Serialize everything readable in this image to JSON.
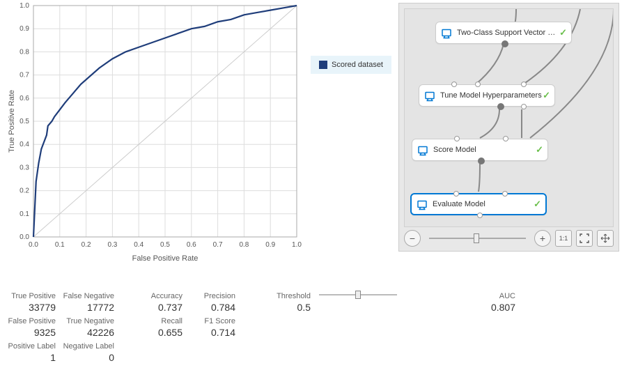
{
  "chart": {
    "xlabel": "False Positive Rate",
    "ylabel": "True Positive Rate",
    "legend": "Scored dataset"
  },
  "chart_data": {
    "type": "line",
    "title": "",
    "xlabel": "False Positive Rate",
    "ylabel": "True Positive Rate",
    "xlim": [
      0.0,
      1.0
    ],
    "ylim": [
      0.0,
      1.0
    ],
    "x_ticks": [
      0.0,
      0.1,
      0.2,
      0.3,
      0.4,
      0.5,
      0.6,
      0.7,
      0.8,
      0.9,
      1.0
    ],
    "y_ticks": [
      0.0,
      0.1,
      0.2,
      0.3,
      0.4,
      0.5,
      0.6,
      0.7,
      0.8,
      0.9,
      1.0
    ],
    "series": [
      {
        "name": "Scored dataset",
        "x": [
          0.0,
          0.01,
          0.02,
          0.025,
          0.03,
          0.04,
          0.05,
          0.055,
          0.07,
          0.08,
          0.1,
          0.12,
          0.15,
          0.18,
          0.2,
          0.25,
          0.3,
          0.35,
          0.4,
          0.45,
          0.5,
          0.55,
          0.6,
          0.65,
          0.7,
          0.75,
          0.8,
          0.85,
          0.9,
          0.95,
          1.0
        ],
        "y": [
          0.0,
          0.24,
          0.32,
          0.35,
          0.38,
          0.41,
          0.44,
          0.48,
          0.5,
          0.52,
          0.55,
          0.58,
          0.62,
          0.66,
          0.68,
          0.73,
          0.77,
          0.8,
          0.82,
          0.84,
          0.86,
          0.88,
          0.9,
          0.91,
          0.93,
          0.94,
          0.96,
          0.97,
          0.98,
          0.99,
          1.0
        ]
      },
      {
        "name": "Reference diagonal",
        "x": [
          0.0,
          1.0
        ],
        "y": [
          0.0,
          1.0
        ]
      }
    ]
  },
  "pipeline": {
    "nodes": [
      {
        "label": "Two-Class Support Vector Ma..."
      },
      {
        "label": "Tune Model Hyperparameters"
      },
      {
        "label": "Score Model"
      },
      {
        "label": "Evaluate Model"
      }
    ]
  },
  "metrics": {
    "tp_label": "True Positive",
    "tp": "33779",
    "fn_label": "False Negative",
    "fn": "17772",
    "fp_label": "False Positive",
    "fp": "9325",
    "tn_label": "True Negative",
    "tn": "42226",
    "acc_label": "Accuracy",
    "acc": "0.737",
    "prec_label": "Precision",
    "prec": "0.784",
    "recall_label": "Recall",
    "recall": "0.655",
    "f1_label": "F1 Score",
    "f1": "0.714",
    "threshold_label": "Threshold",
    "threshold": "0.5",
    "auc_label": "AUC",
    "auc": "0.807",
    "pos_label_label": "Positive Label",
    "pos": "1",
    "neg_label_label": "Negative Label",
    "neg": "0"
  }
}
